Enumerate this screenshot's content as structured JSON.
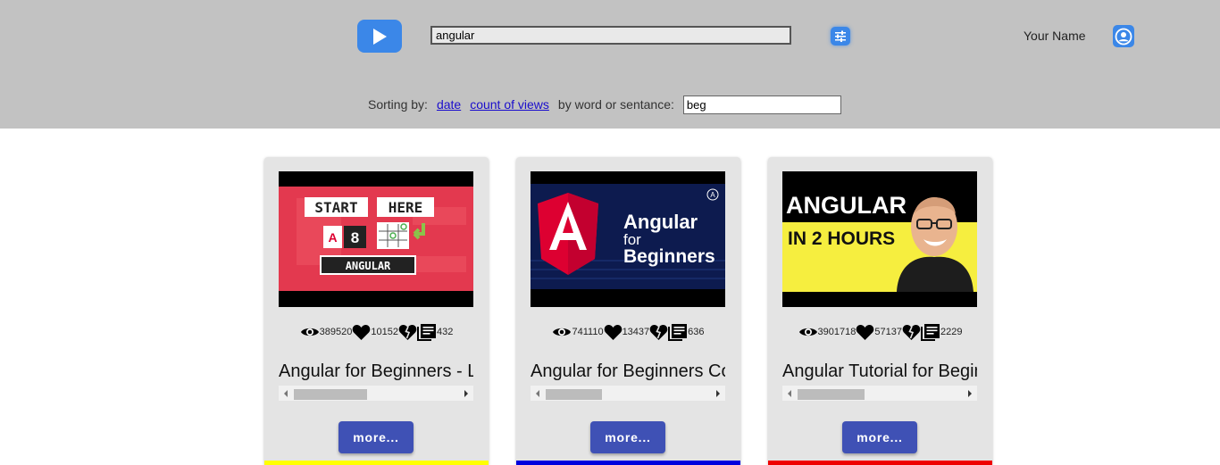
{
  "header": {
    "search_value": "angular",
    "user_name": "Your Name",
    "accent_color": "#3b87e8"
  },
  "sorting": {
    "label": "Sorting by:",
    "date_link": "date",
    "views_link": "count of views",
    "word_label": "by word or sentance:",
    "word_value": "beg"
  },
  "cards": [
    {
      "thumbnail": "angular-start-here-thumbnail",
      "thumb_text": [
        "START",
        "HERE",
        "A",
        "8",
        "ANGULAR"
      ],
      "views": "389520",
      "likes": "10152",
      "dislikes": "",
      "comments": "432",
      "title": "Angular for Beginners - Let's build a Tic-Tac-Toe PWA",
      "more_label": "more...",
      "bar_color": "#ffff00"
    },
    {
      "thumbnail": "angular-for-beginners-thumbnail",
      "thumb_text": [
        "Angular",
        "for",
        "Beginners"
      ],
      "views": "741110",
      "likes": "13437",
      "dislikes": "",
      "comments": "636",
      "title": "Angular for Beginners Course",
      "more_label": "more...",
      "bar_color": "#0000dd"
    },
    {
      "thumbnail": "angular-in-2-hours-thumbnail",
      "thumb_text": [
        "ANGULAR",
        "IN 2 HOURS"
      ],
      "views": "3901718",
      "likes": "57137",
      "dislikes": "",
      "comments": "2229",
      "title": "Angular Tutorial for Beginners",
      "more_label": "more...",
      "bar_color": "#ee0000"
    }
  ]
}
